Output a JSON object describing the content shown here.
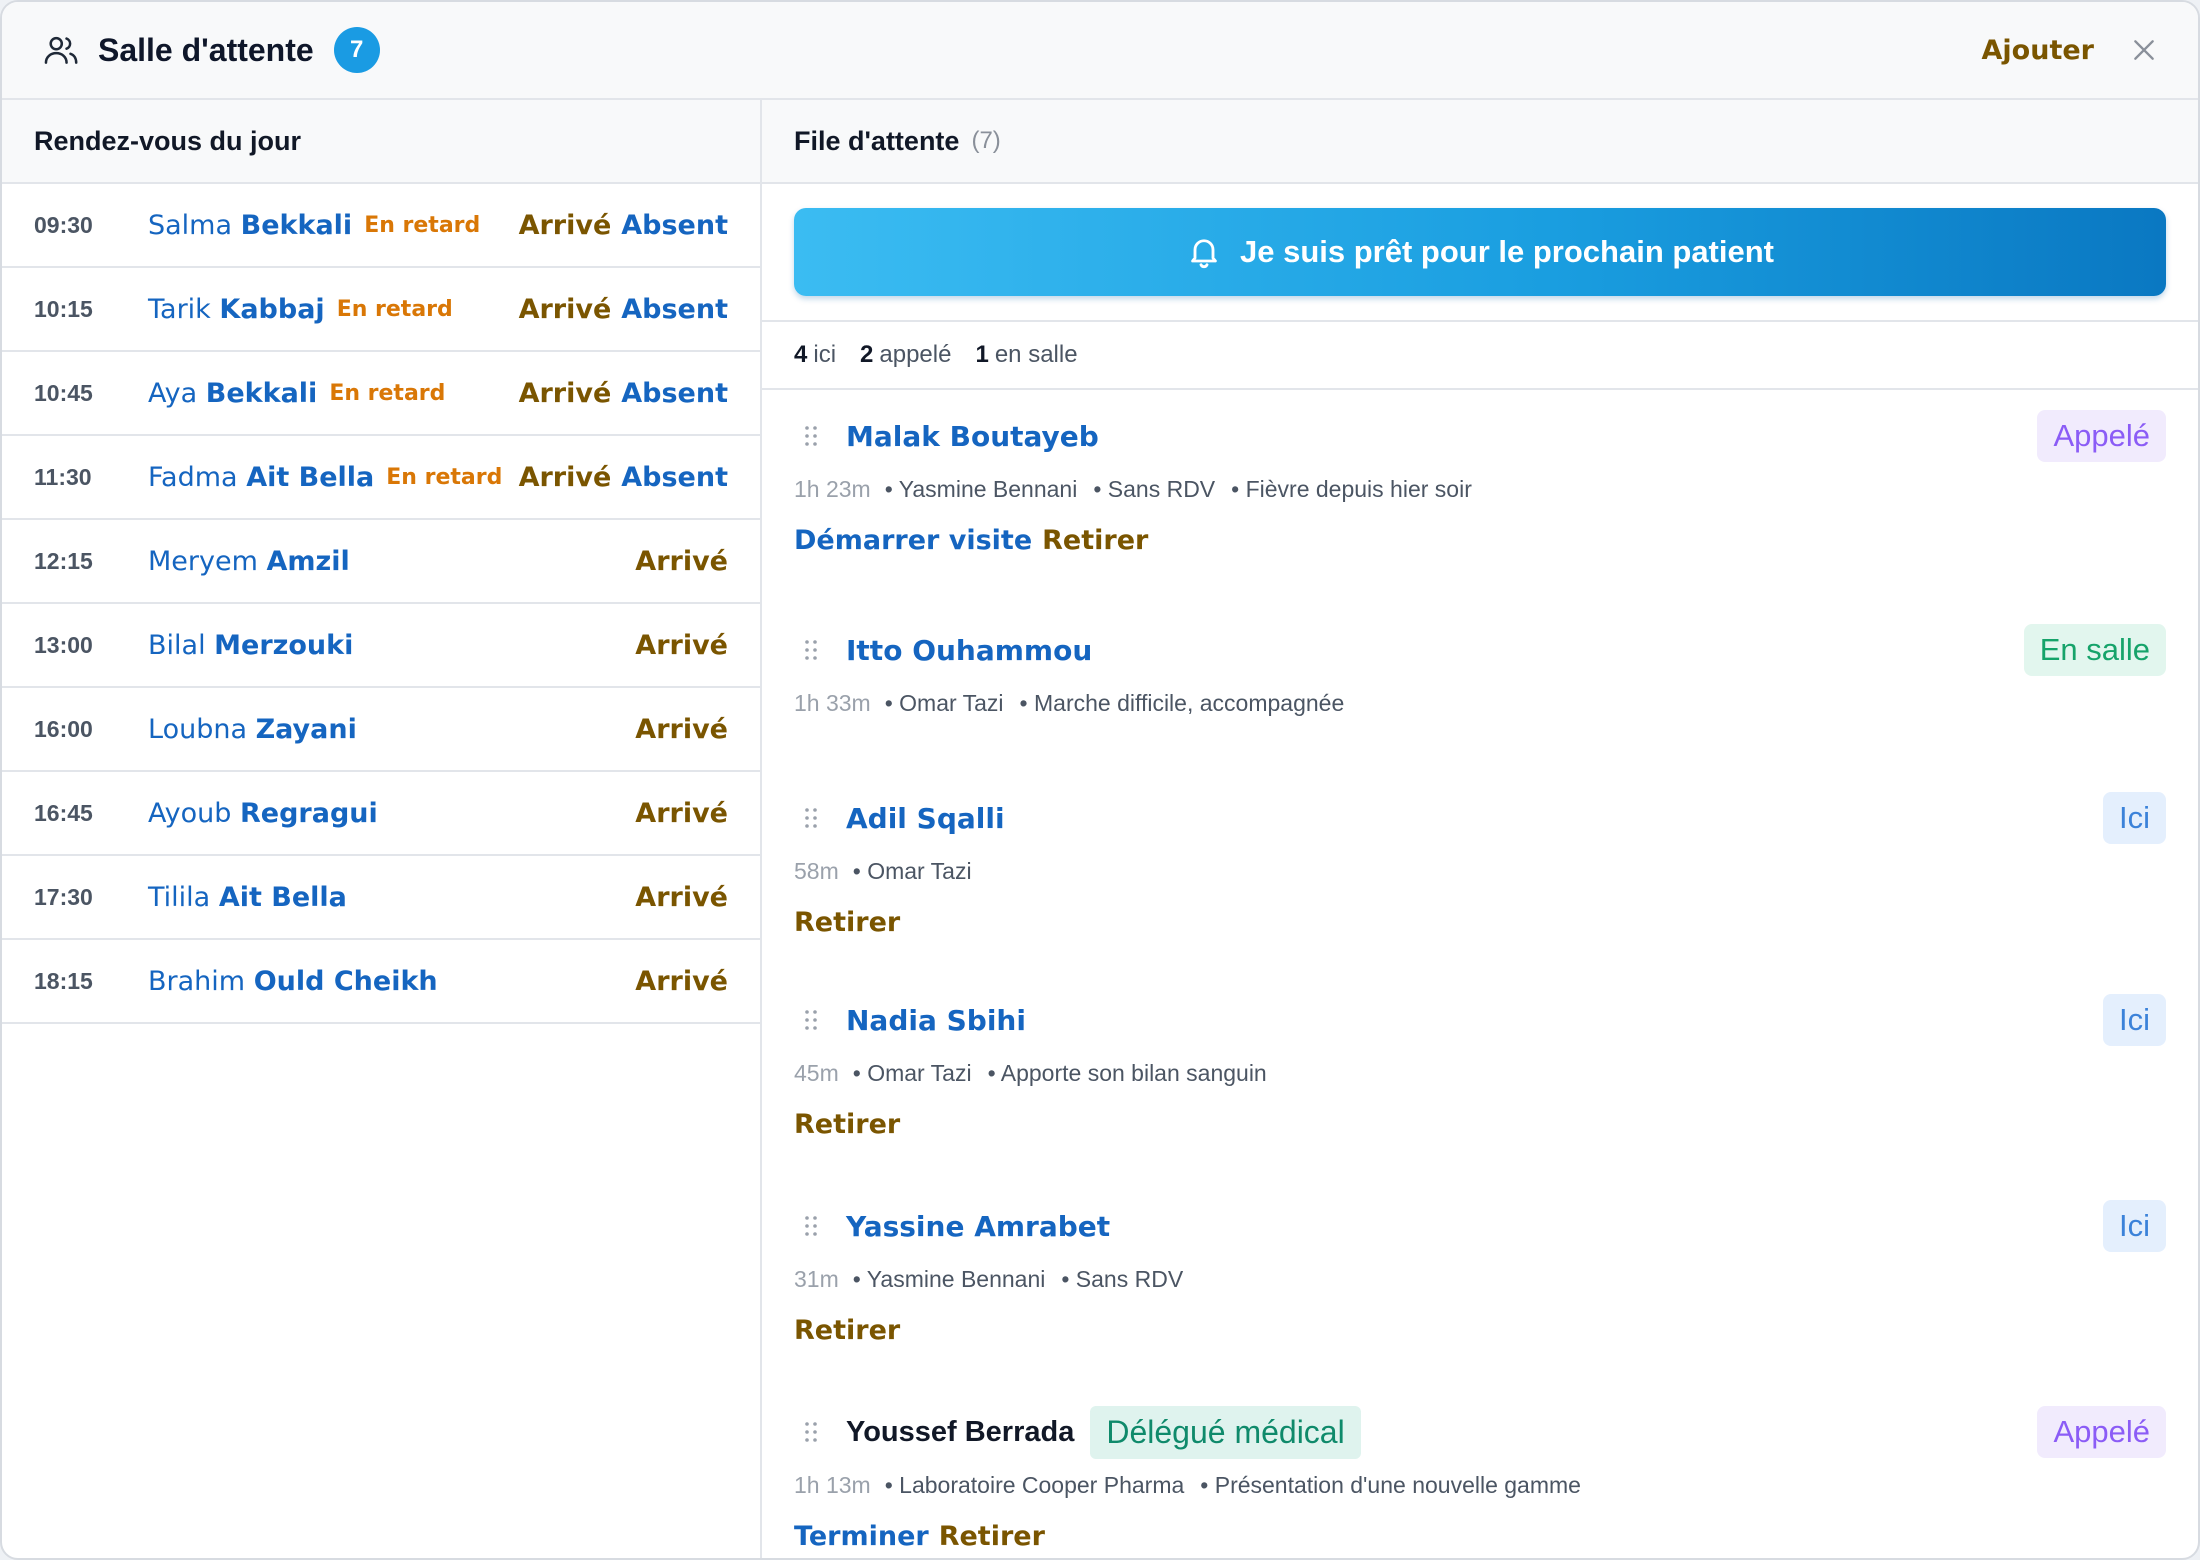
{
  "header": {
    "title": "Salle d'attente",
    "count": "7",
    "add_label": "Ajouter",
    "icon": "users-icon",
    "close_icon": "close-icon"
  },
  "left": {
    "title": "Rendez-vous du jour",
    "appointments": [
      {
        "time": "09:30",
        "first": "Salma",
        "last": "Bekkali",
        "late": "En retard",
        "arrive": "Arrivé",
        "absent": "Absent"
      },
      {
        "time": "10:15",
        "first": "Tarik",
        "last": "Kabbaj",
        "late": "En retard",
        "arrive": "Arrivé",
        "absent": "Absent"
      },
      {
        "time": "10:45",
        "first": "Aya",
        "last": "Bekkali",
        "late": "En retard",
        "arrive": "Arrivé",
        "absent": "Absent"
      },
      {
        "time": "11:30",
        "first": "Fadma",
        "last": "Ait Bella",
        "late": "En retard",
        "arrive": "Arrivé",
        "absent": "Absent"
      },
      {
        "time": "12:15",
        "first": "Meryem",
        "last": "Amzil",
        "arrive": "Arrivé"
      },
      {
        "time": "13:00",
        "first": "Bilal",
        "last": "Merzouki",
        "arrive": "Arrivé"
      },
      {
        "time": "16:00",
        "first": "Loubna",
        "last": "Zayani",
        "arrive": "Arrivé"
      },
      {
        "time": "16:45",
        "first": "Ayoub",
        "last": "Regragui",
        "arrive": "Arrivé"
      },
      {
        "time": "17:30",
        "first": "Tilila",
        "last": "Ait Bella",
        "arrive": "Arrivé"
      },
      {
        "time": "18:15",
        "first": "Brahim",
        "last": "Ould Cheikh",
        "arrive": "Arrivé"
      }
    ]
  },
  "right": {
    "title": "File d'attente",
    "count": "(7)",
    "ready_button": "Je suis prêt pour le prochain patient",
    "stats": [
      {
        "num": "4",
        "label": "ici"
      },
      {
        "num": "2",
        "label": "appelé"
      },
      {
        "num": "1",
        "label": "en salle"
      }
    ],
    "queue": [
      {
        "first": "Malak",
        "last": "Boutayeb",
        "status": "Appelé",
        "status_kind": "called",
        "wait": "1h 23m",
        "meta": [
          "• Yasmine Bennani",
          "• Sans RDV",
          "• Fièvre depuis hier soir"
        ],
        "actions": [
          {
            "label": "Démarrer visite",
            "kind": "blue"
          },
          {
            "label": "Retirer",
            "kind": "gold"
          }
        ]
      },
      {
        "first": "Itto",
        "last": "Ouhammou",
        "status": "En salle",
        "status_kind": "room",
        "wait": "1h 33m",
        "meta": [
          "• Omar Tazi",
          "• Marche difficile, accompagnée"
        ],
        "actions": []
      },
      {
        "first": "Adil",
        "last": "Sqalli",
        "status": "Ici",
        "status_kind": "here",
        "wait": "58m",
        "meta": [
          "• Omar Tazi"
        ],
        "actions": [
          {
            "label": "Retirer",
            "kind": "gold"
          }
        ]
      },
      {
        "first": "Nadia",
        "last": "Sbihi",
        "status": "Ici",
        "status_kind": "here",
        "wait": "45m",
        "meta": [
          "• Omar Tazi",
          "• Apporte son bilan sanguin"
        ],
        "actions": [
          {
            "label": "Retirer",
            "kind": "gold"
          }
        ]
      },
      {
        "first": "Yassine",
        "last": "Amrabet",
        "status": "Ici",
        "status_kind": "here",
        "wait": "31m",
        "meta": [
          "• Yasmine Bennani",
          "• Sans RDV"
        ],
        "actions": [
          {
            "label": "Retirer",
            "kind": "gold"
          }
        ]
      },
      {
        "name": "Youssef Berrada",
        "tag": "Délégué médical",
        "status": "Appelé",
        "status_kind": "called",
        "wait": "1h 13m",
        "meta": [
          "• Laboratoire Cooper Pharma",
          "• Présentation d'une nouvelle gamme"
        ],
        "actions": [
          {
            "label": "Terminer",
            "kind": "blue"
          },
          {
            "label": "Retirer",
            "kind": "gold"
          }
        ]
      }
    ]
  }
}
